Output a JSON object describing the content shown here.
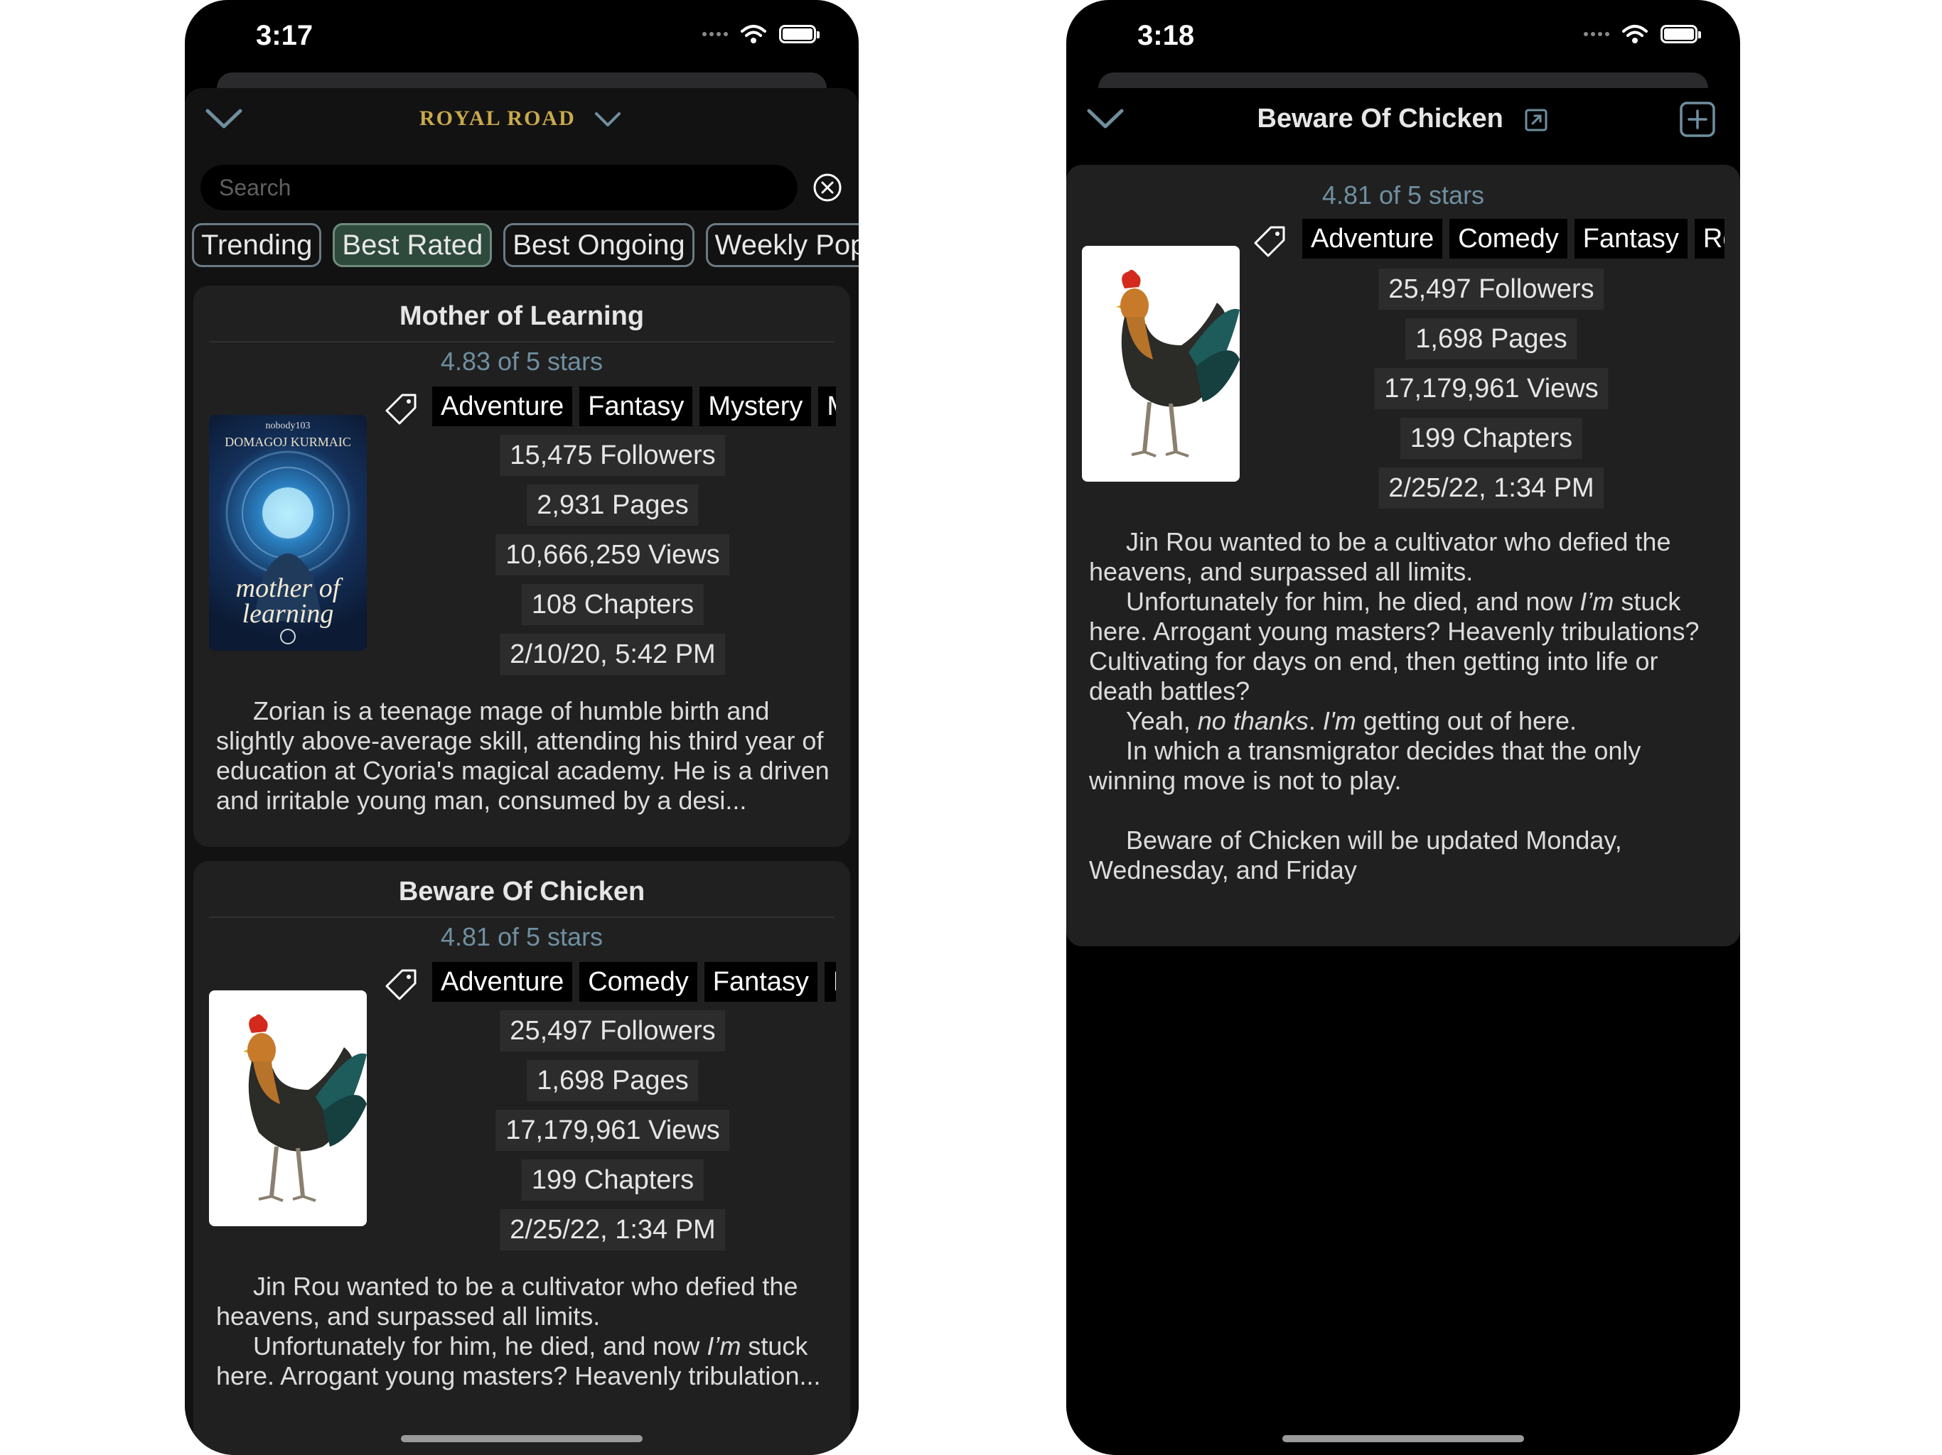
{
  "left": {
    "status_time": "3:17",
    "logo": "ROYAL ROAD",
    "search_placeholder": "Search",
    "tabs": [
      "Trending",
      "Best Rated",
      "Best Ongoing",
      "Weekly Popular"
    ],
    "active_tab": "Best Rated",
    "cards": [
      {
        "title": "Mother of Learning",
        "rating": "4.83 of 5 stars",
        "tags": [
          "Adventure",
          "Fantasy",
          "Mystery",
          "Magic"
        ],
        "followers": "15,475 Followers",
        "pages": "2,931 Pages",
        "views": "10,666,259 Views",
        "chapters": "108 Chapters",
        "date": "2/10/20, 5:42 PM",
        "cover_author": "nobody103",
        "cover_name": "DOMAGOJ KURMAIC",
        "cover_title": "mother of learning",
        "description": "Zorian is a teenage mage of humble birth and slightly above-average skill, attending his third year of education at Cyoria's magical academy. He is a driven and irritable young man, consumed by a desi..."
      },
      {
        "title": "Beware Of Chicken",
        "rating": "4.81 of 5 stars",
        "tags": [
          "Adventure",
          "Comedy",
          "Fantasy",
          "Fantasy"
        ],
        "followers": "25,497 Followers",
        "pages": "1,698 Pages",
        "views": "17,179,961 Views",
        "chapters": "199 Chapters",
        "date": "2/25/22, 1:34 PM",
        "description_1": "Jin Rou wanted to be a cultivator who defied the heavens, and surpassed all limits.",
        "description_2a": "Unfortunately for him, he died, and now ",
        "description_2b": "I’m",
        "description_2c": " stuck here. Arrogant young masters? Heavenly tribulation..."
      }
    ]
  },
  "right": {
    "status_time": "3:18",
    "title": "Beware Of Chicken",
    "rating": "4.81 of 5 stars",
    "tags": [
      "Adventure",
      "Comedy",
      "Fantasy",
      "Romance"
    ],
    "followers": "25,497 Followers",
    "pages": "1,698 Pages",
    "views": "17,179,961 Views",
    "chapters": "199 Chapters",
    "date": "2/25/22, 1:34 PM",
    "para1": "Jin Rou wanted to be a cultivator who defied the heavens, and surpassed all limits.",
    "para2a": "Unfortunately for him, he died, and now ",
    "para2b": "I’m",
    "para2c": " stuck here. Arrogant young masters? Heavenly tribulations? Cultivating for days on end, then getting into life or death battles?",
    "para3a": "Yeah, ",
    "para3b": "no thanks",
    "para3c": ". ",
    "para3d": "I'm",
    "para3e": " getting out of here.",
    "para4": "In which a transmigrator decides that the only winning move is not to play.",
    "para5": "Beware of Chicken will be updated Monday, Wednesday, and Friday"
  },
  "colors": {
    "accent_rating": "#6f8fa0",
    "active_tab_bg": "#2e4a3c",
    "logo_gold": "#c9a94b",
    "card_bg": "#202020",
    "stat_bg": "#2c2c2c"
  },
  "icons": [
    "chevron-down-icon",
    "clear-icon",
    "tag-icon",
    "external-link-icon",
    "add-icon",
    "wifi-icon",
    "battery-icon"
  ]
}
